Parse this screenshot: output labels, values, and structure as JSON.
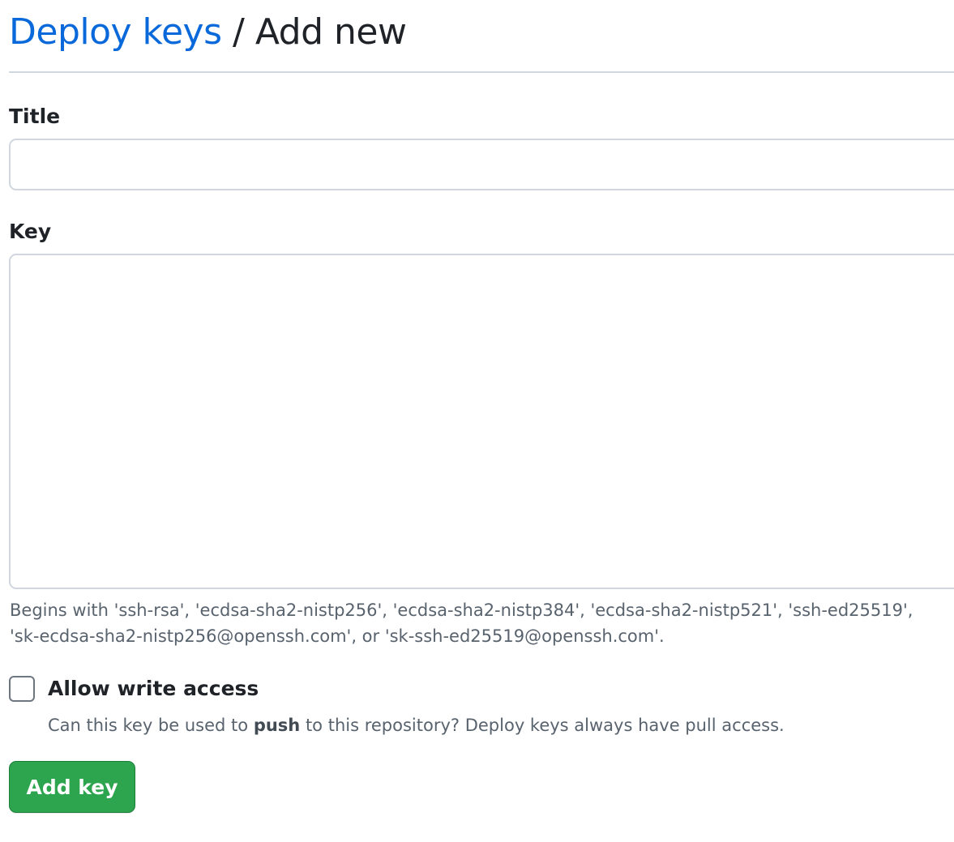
{
  "breadcrumb": {
    "parent_label": "Deploy keys",
    "separator": "/",
    "current_label": "Add new"
  },
  "form": {
    "title_label": "Title",
    "title_value": "",
    "key_label": "Key",
    "key_value": "",
    "key_hint_line1": "Begins with 'ssh-rsa', 'ecdsa-sha2-nistp256', 'ecdsa-sha2-nistp384', 'ecdsa-sha2-nistp521', 'ssh-ed25519',",
    "key_hint_line2": "'sk-ecdsa-sha2-nistp256@openssh.com', or 'sk-ssh-ed25519@openssh.com'.",
    "write_access": {
      "label": "Allow write access",
      "checked": false,
      "note_before": "Can this key be used to",
      "note_bold": "push",
      "note_after": "to this repository? Deploy keys always have pull access."
    },
    "submit_label": "Add key"
  },
  "colors": {
    "link": "#0969da",
    "primary_button": "#2da44e",
    "border": "#d0d7de",
    "muted_text": "#59636e"
  }
}
